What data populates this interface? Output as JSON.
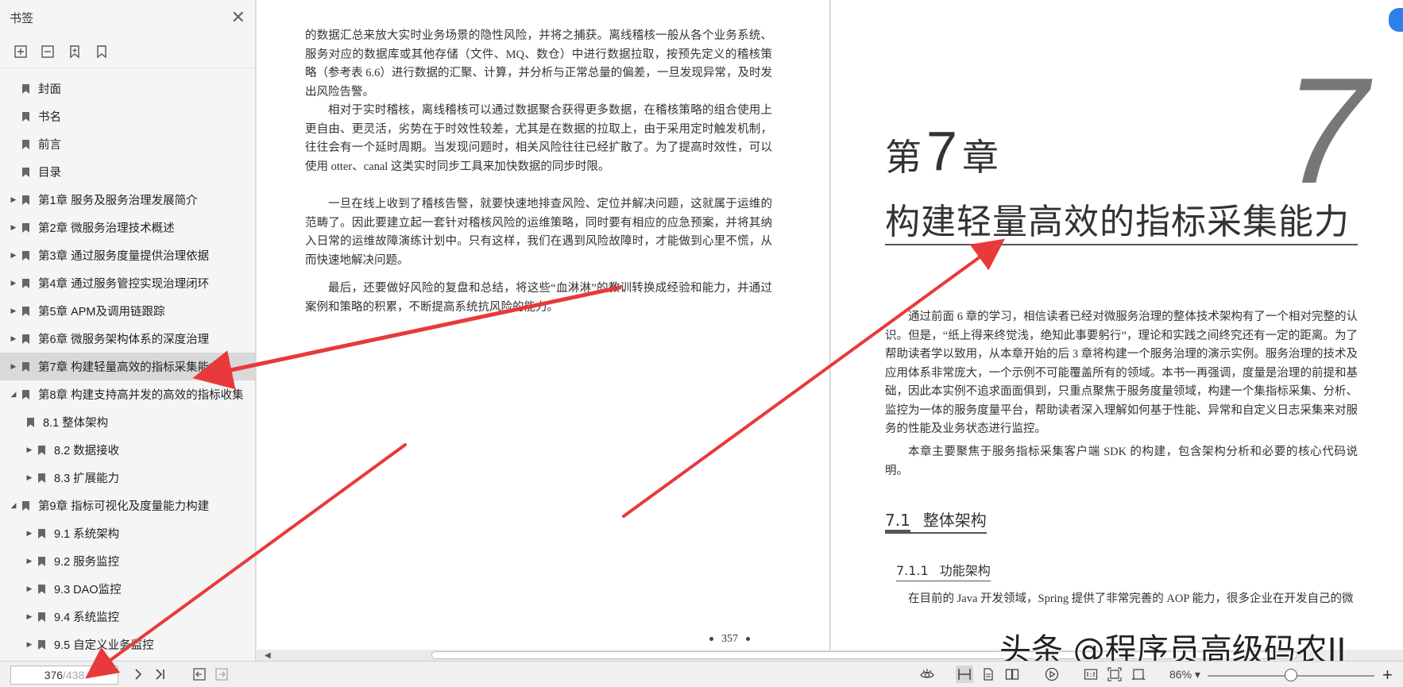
{
  "sidebar": {
    "title": "书签",
    "tools": [
      "add-bookmark-icon",
      "delete-bookmark-icon",
      "bookmark-icon",
      "bookmark-outline-icon"
    ],
    "items": [
      {
        "label": "封面",
        "level": 0,
        "arrow": ""
      },
      {
        "label": "书名",
        "level": 0,
        "arrow": ""
      },
      {
        "label": "前言",
        "level": 0,
        "arrow": ""
      },
      {
        "label": "目录",
        "level": 0,
        "arrow": ""
      },
      {
        "label": "第1章 服务及服务治理发展简介",
        "level": 0,
        "arrow": "▶"
      },
      {
        "label": "第2章 微服务治理技术概述",
        "level": 0,
        "arrow": "▶"
      },
      {
        "label": "第3章 通过服务度量提供治理依据",
        "level": 0,
        "arrow": "▶"
      },
      {
        "label": "第4章 通过服务管控实现治理闭环",
        "level": 0,
        "arrow": "▶"
      },
      {
        "label": "第5章 APM及调用链跟踪",
        "level": 0,
        "arrow": "▶"
      },
      {
        "label": "第6章 微服务架构体系的深度治理",
        "level": 0,
        "arrow": "▶"
      },
      {
        "label": "第7章 构建轻量高效的指标采集能力",
        "level": 0,
        "arrow": "▶"
      },
      {
        "label": "第8章 构建支持高并发的高效的指标收集",
        "level": 0,
        "arrow": "◢"
      },
      {
        "label": "8.1 整体架构",
        "level": 1,
        "arrow": ""
      },
      {
        "label": "8.2 数据接收",
        "level": 1,
        "arrow": "▶"
      },
      {
        "label": "8.3 扩展能力",
        "level": 1,
        "arrow": "▶"
      },
      {
        "label": "第9章 指标可视化及度量能力构建",
        "level": 0,
        "arrow": "◢"
      },
      {
        "label": "9.1 系统架构",
        "level": 1,
        "arrow": "▶"
      },
      {
        "label": "9.2 服务监控",
        "level": 1,
        "arrow": "▶"
      },
      {
        "label": "9.3 DAO监控",
        "level": 1,
        "arrow": "▶"
      },
      {
        "label": "9.4 系统监控",
        "level": 1,
        "arrow": "▶"
      },
      {
        "label": "9.5 自定义业务监控",
        "level": 1,
        "arrow": "▶"
      }
    ],
    "selected_index": 10
  },
  "left_page": {
    "paragraphs": [
      "的数据汇总来放大实时业务场景的隐性风险，并将之捕获。离线稽核一般从各个业务系统、服务对应的数据库或其他存储（文件、MQ、数仓）中进行数据拉取，按预先定义的稽核策略（参考表 6.6）进行数据的汇聚、计算，并分析与正常总量的偏差，一旦发现异常，及时发出风险告警。",
      "相对于实时稽核，离线稽核可以通过数据聚合获得更多数据，在稽核策略的组合使用上更自由、更灵活，劣势在于时效性较差，尤其是在数据的拉取上，由于采用定时触发机制，往往会有一个延时周期。当发现问题时，相关风险往往已经扩散了。为了提高时效性，可以使用 otter、canal 这类实时同步工具来加快数据的同步时限。",
      "一旦在线上收到了稽核告警，就要快速地排查风险、定位并解决问题，这就属于运维的范畴了。因此要建立起一套针对稽核风险的运维策略，同时要有相应的应急预案，并将其纳入日常的运维故障演练计划中。只有这样，我们在遇到风险故障时，才能做到心里不慌，从而快速地解决问题。",
      "最后，还要做好风险的复盘和总结，将这些“血淋淋”的教训转换成经验和能力，并通过案例和策略的积累，不断提高系统抗风险的能力。"
    ],
    "page_number": "357"
  },
  "right_page": {
    "big_number": "7",
    "chapter_prefix": "第",
    "chapter_num": "7",
    "chapter_suffix": "章",
    "chapter_title": "构建轻量高效的指标采集能力",
    "paragraphs": [
      "通过前面 6 章的学习，相信读者已经对微服务治理的整体技术架构有了一个相对完整的认识。但是，“纸上得来终觉浅，绝知此事要躬行”，理论和实践之间终究还有一定的距离。为了帮助读者学以致用，从本章开始的后 3 章将构建一个服务治理的演示实例。服务治理的技术及应用体系非常庞大，一个示例不可能覆盖所有的领域。本书一再强调，度量是治理的前提和基础，因此本实例不追求面面俱到，只重点聚焦于服务度量领域，构建一个集指标采集、分析、监控为一体的服务度量平台，帮助读者深入理解如何基于性能、异常和自定义日志采集来对服务的性能及业务状态进行监控。",
      "本章主要聚焦于服务指标采集客户端 SDK 的构建，包含架构分析和必要的核心代码说明。"
    ],
    "section_num": "7.1",
    "section_title": "整体架构",
    "subsection_num": "7.1.1",
    "subsection_title": "功能架构",
    "last_line": "在目前的 Java 开发领域，Spring 提供了非常完善的 AOP 能力，很多企业在开发自己的微"
  },
  "watermark": "头条 @程序员高级码农II",
  "bottombar": {
    "current_page": "376",
    "total_pages": "/438",
    "zoom": "86%",
    "zoom_level": 0.5
  },
  "colors": {
    "arrow": "#e8393b",
    "sidebar_bg": "#f5f5f5",
    "selected_bg": "#d9d9d9",
    "accent_badge": "#2f7fe8"
  }
}
